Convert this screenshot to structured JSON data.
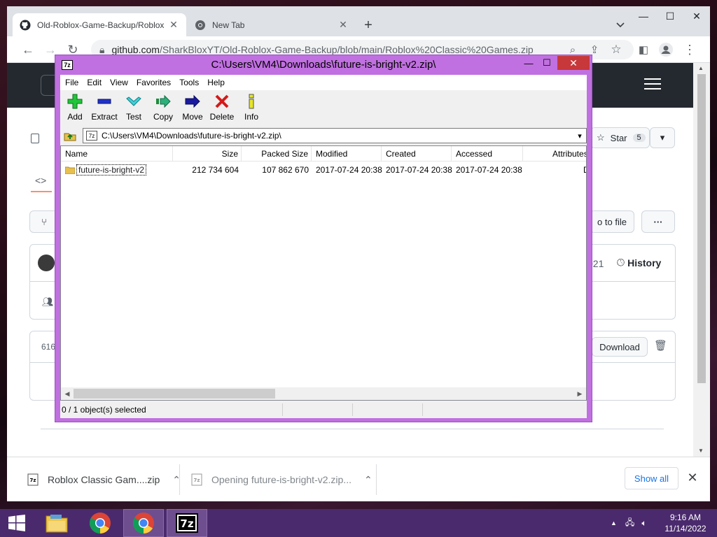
{
  "browser": {
    "tabs": [
      {
        "title": "Old-Roblox-Game-Backup/Roblox",
        "favicon": "github-icon",
        "active": true
      },
      {
        "title": "New Tab",
        "favicon": "chrome-icon",
        "active": false
      }
    ],
    "url_host": "github.com",
    "url_path": "/SharkBloxYT/Old-Roblox-Game-Backup/blob/main/Roblox%20Classic%20Games.zip"
  },
  "github": {
    "star_label": "Star",
    "star_count": "5",
    "go_to_file_partial": "o to file",
    "history_label": "History",
    "date_partial": "021",
    "file_size_partial": "616",
    "download_label": "Download"
  },
  "sevenzip": {
    "title": "C:\\Users\\VM4\\Downloads\\future-is-bright-v2.zip\\",
    "app_icon_text": "7z",
    "menu": [
      "File",
      "Edit",
      "View",
      "Favorites",
      "Tools",
      "Help"
    ],
    "toolbar": [
      {
        "label": "Add",
        "icon": "add-icon"
      },
      {
        "label": "Extract",
        "icon": "extract-icon"
      },
      {
        "label": "Test",
        "icon": "test-icon"
      },
      {
        "label": "Copy",
        "icon": "copy-icon"
      },
      {
        "label": "Move",
        "icon": "move-icon"
      },
      {
        "label": "Delete",
        "icon": "delete-icon"
      },
      {
        "label": "Info",
        "icon": "info-icon"
      }
    ],
    "address": "C:\\Users\\VM4\\Downloads\\future-is-bright-v2.zip\\",
    "columns": [
      "Name",
      "Size",
      "Packed Size",
      "Modified",
      "Created",
      "Accessed",
      "Attributes"
    ],
    "rows": [
      {
        "name": "future-is-bright-v2",
        "size": "212 734 604",
        "packed_size": "107 862 670",
        "modified": "2017-07-24 20:38",
        "created": "2017-07-24 20:38",
        "accessed": "2017-07-24 20:38",
        "attributes": "D"
      }
    ],
    "status": "0 / 1 object(s) selected"
  },
  "downloads": {
    "items": [
      {
        "name": "Roblox Classic Gam....zip",
        "state": "done"
      },
      {
        "name": "Opening future-is-bright-v2.zip...",
        "state": "opening"
      }
    ],
    "show_all": "Show all"
  },
  "taskbar": {
    "apps": [
      "file-explorer-icon",
      "chrome-icon",
      "chrome-icon",
      "7zip-icon"
    ],
    "time": "9:16 AM",
    "date": "11/14/2022"
  },
  "colors": {
    "sevenzip_frame": "#c070e0",
    "taskbar": "#4a2a6c",
    "github_header": "#24292f",
    "chrome_tabstrip": "#dee1e6"
  }
}
